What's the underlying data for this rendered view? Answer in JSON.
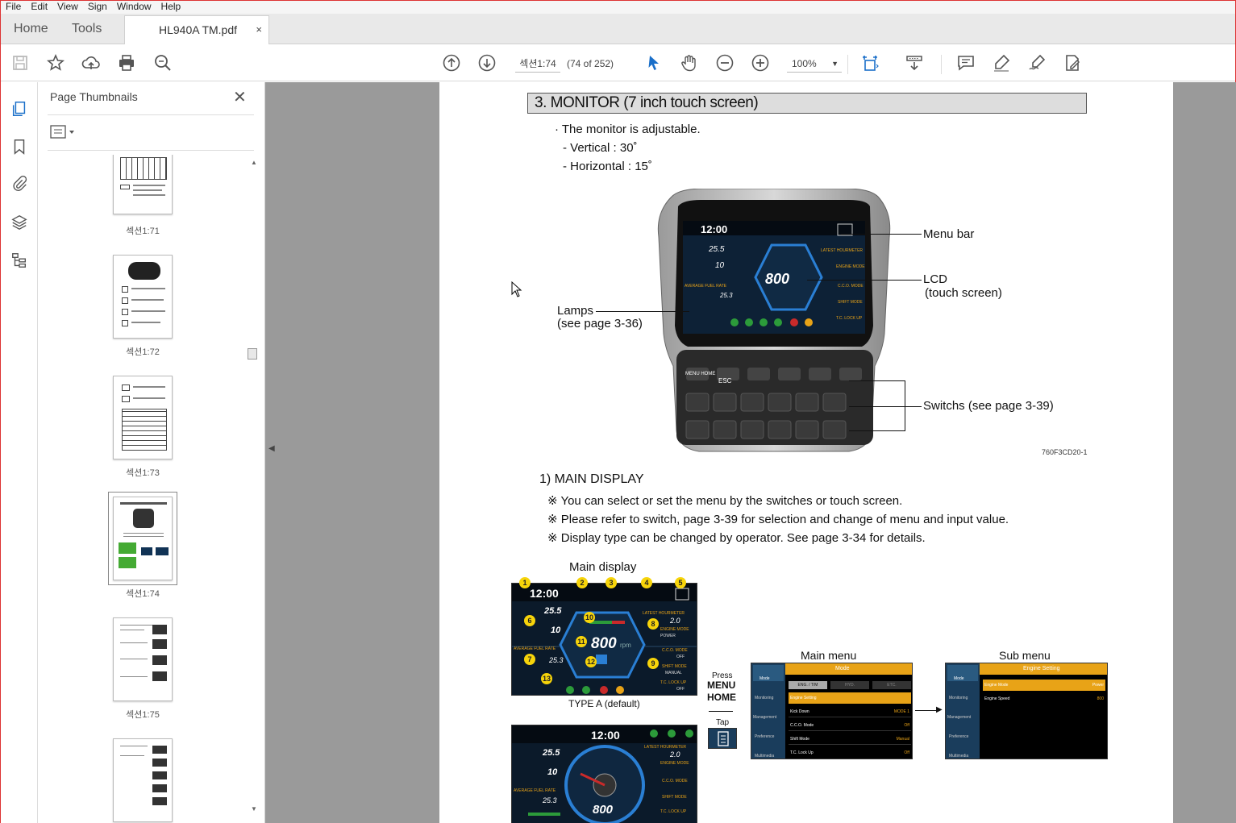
{
  "menubar": [
    "File",
    "Edit",
    "View",
    "Sign",
    "Window",
    "Help"
  ],
  "tabs": {
    "home": "Home",
    "tools": "Tools",
    "document": "HL940A TM.pdf",
    "close": "×"
  },
  "toolbar": {
    "page_label": "섹션1:74",
    "page_count": "(74 of 252)",
    "zoom": "100%"
  },
  "thumbnails": {
    "title": "Page Thumbnails",
    "close": "✕",
    "items": [
      {
        "label": "섹션1:71"
      },
      {
        "label": "섹션1:72"
      },
      {
        "label": "섹션1:73"
      },
      {
        "label": "섹션1:74",
        "selected": true
      },
      {
        "label": "섹션1:75"
      }
    ]
  },
  "document": {
    "section_title": "3. MONITOR (7 inch touch screen)",
    "intro": "· The monitor is adjustable.",
    "vertical": "- Vertical : 30˚",
    "horizontal": "- Horizontal : 15˚",
    "callouts": {
      "menu_bar": "Menu bar",
      "lcd": "LCD",
      "lcd_sub": "(touch screen)",
      "lamps": "Lamps",
      "lamps_sub": "(see page 3-36)",
      "switchs": "Switchs (see page 3-39)"
    },
    "figure_code": "760F3CD20-1",
    "main_display_heading": "1) MAIN DISPLAY",
    "notes": [
      "※ You can select or set the menu by the switches or touch screen.",
      "※ Please refer to switch, page 3-39 for selection and change of menu and input value.",
      "※ Display type can be changed by operator. See page 3-34 for details."
    ],
    "main_display_label": "Main display",
    "type_a": "TYPE A (default)",
    "press": "Press",
    "menu_home_1": "MENU",
    "menu_home_2": "HOME",
    "tap": "Tap",
    "main_menu": "Main menu",
    "sub_menu": "Sub menu",
    "screen": {
      "time": "12:00",
      "voltage": "25.5",
      "temp": "10",
      "rpm": "800",
      "rpm_unit": "rpm",
      "fuel_rate": "25.3",
      "hourmeter": "2.0",
      "latest_hourmeter": "LATEST HOURMETER",
      "engine_mode": "ENGINE MODE",
      "power": "POWER",
      "avg_fuel": "AVERAGE FUEL RATE",
      "cco_mode": "C.C.O. MODE",
      "off": "OFF",
      "shift_mode": "SHIFT MODE",
      "manual": "MANUAL",
      "tc_lockup": "T.C. LOCK UP"
    },
    "badges": [
      "1",
      "2",
      "3",
      "4",
      "5",
      "6",
      "7",
      "8",
      "9",
      "10",
      "11",
      "12",
      "13"
    ],
    "menu_screen": {
      "title": "Mode",
      "tabs": [
        "ENG. / T/M",
        "HYD.",
        "ETC."
      ],
      "rows": [
        {
          "name": "Engine Setting",
          "value": ""
        },
        {
          "name": "Kick Down",
          "value": "MODE 1"
        },
        {
          "name": "C.C.O. Mode",
          "value": "Off"
        },
        {
          "name": "Shift Mode",
          "value": "Manual"
        },
        {
          "name": "T.C. Lock Up",
          "value": "Off"
        }
      ],
      "side": [
        "Mode",
        "Monitoring",
        "Management",
        "Preference",
        "Multimedia"
      ]
    },
    "sub_screen": {
      "title": "Engine Setting",
      "rows": [
        {
          "name": "Engine Mode",
          "value": "Power"
        },
        {
          "name": "Engine Speed",
          "value": "800"
        }
      ]
    },
    "keypad": {
      "menu_home": "MENU HOME",
      "esc": "ESC"
    }
  },
  "colors": {
    "accent_orange": "#e8a317",
    "screen_bg": "#0b1a2a",
    "hex_blue": "#2a7fd4"
  }
}
